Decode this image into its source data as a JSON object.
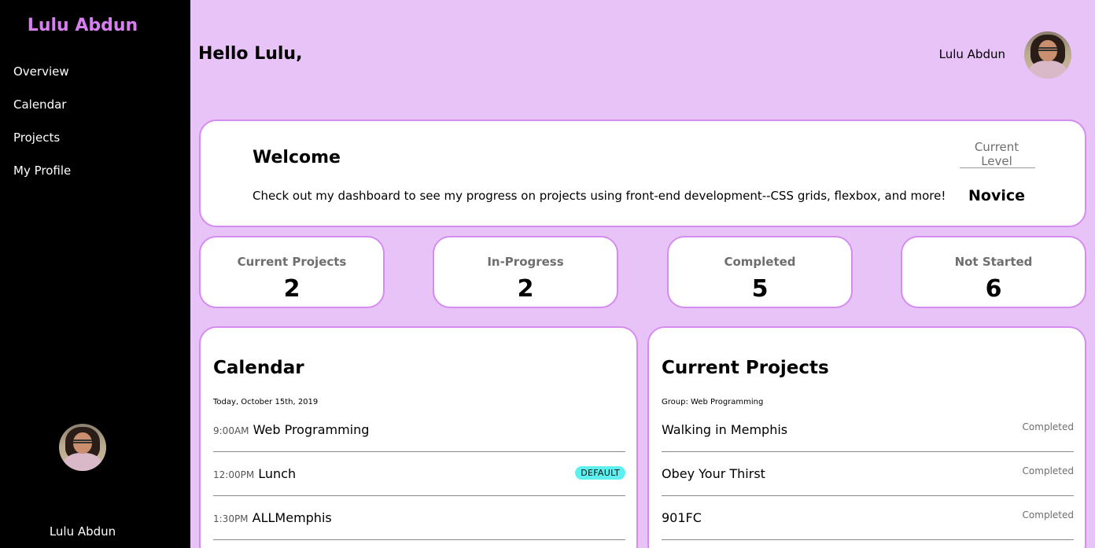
{
  "sidebar": {
    "brand": "Lulu Abdun",
    "nav": [
      {
        "label": "Overview"
      },
      {
        "label": "Calendar"
      },
      {
        "label": "Projects"
      },
      {
        "label": "My Profile"
      }
    ],
    "user_name": "Lulu Abdun"
  },
  "header": {
    "greeting": "Hello Lulu,",
    "user_name": "Lulu Abdun"
  },
  "welcome": {
    "title": "Welcome",
    "text": "Check out my dashboard to see my progress on projects using front-end development--CSS grids, flexbox, and more!",
    "level_label": "Current Level",
    "level_value": "Novice"
  },
  "stats": [
    {
      "label": "Current Projects",
      "value": "2"
    },
    {
      "label": "In-Progress",
      "value": "2"
    },
    {
      "label": "Completed",
      "value": "5"
    },
    {
      "label": "Not Started",
      "value": "6"
    }
  ],
  "calendar": {
    "title": "Calendar",
    "date": "Today, October 15th, 2019",
    "events": [
      {
        "time": "9:00AM",
        "title": "Web Programming",
        "badge": ""
      },
      {
        "time": "12:00PM",
        "title": "Lunch",
        "badge": "DEFAULT"
      },
      {
        "time": "1:30PM",
        "title": "ALLMemphis",
        "badge": ""
      }
    ]
  },
  "projects": {
    "title": "Current Projects",
    "group": "Group: Web Programming",
    "items": [
      {
        "title": "Walking in Memphis",
        "status": "Completed"
      },
      {
        "title": "Obey Your Thirst",
        "status": "Completed"
      },
      {
        "title": "901FC",
        "status": "Completed"
      }
    ]
  },
  "colors": {
    "background": "#e8c3f7",
    "sidebar": "#000000",
    "brand": "#d77ff0",
    "card_border": "#d58cf0",
    "badge": "#5ef0ef"
  }
}
